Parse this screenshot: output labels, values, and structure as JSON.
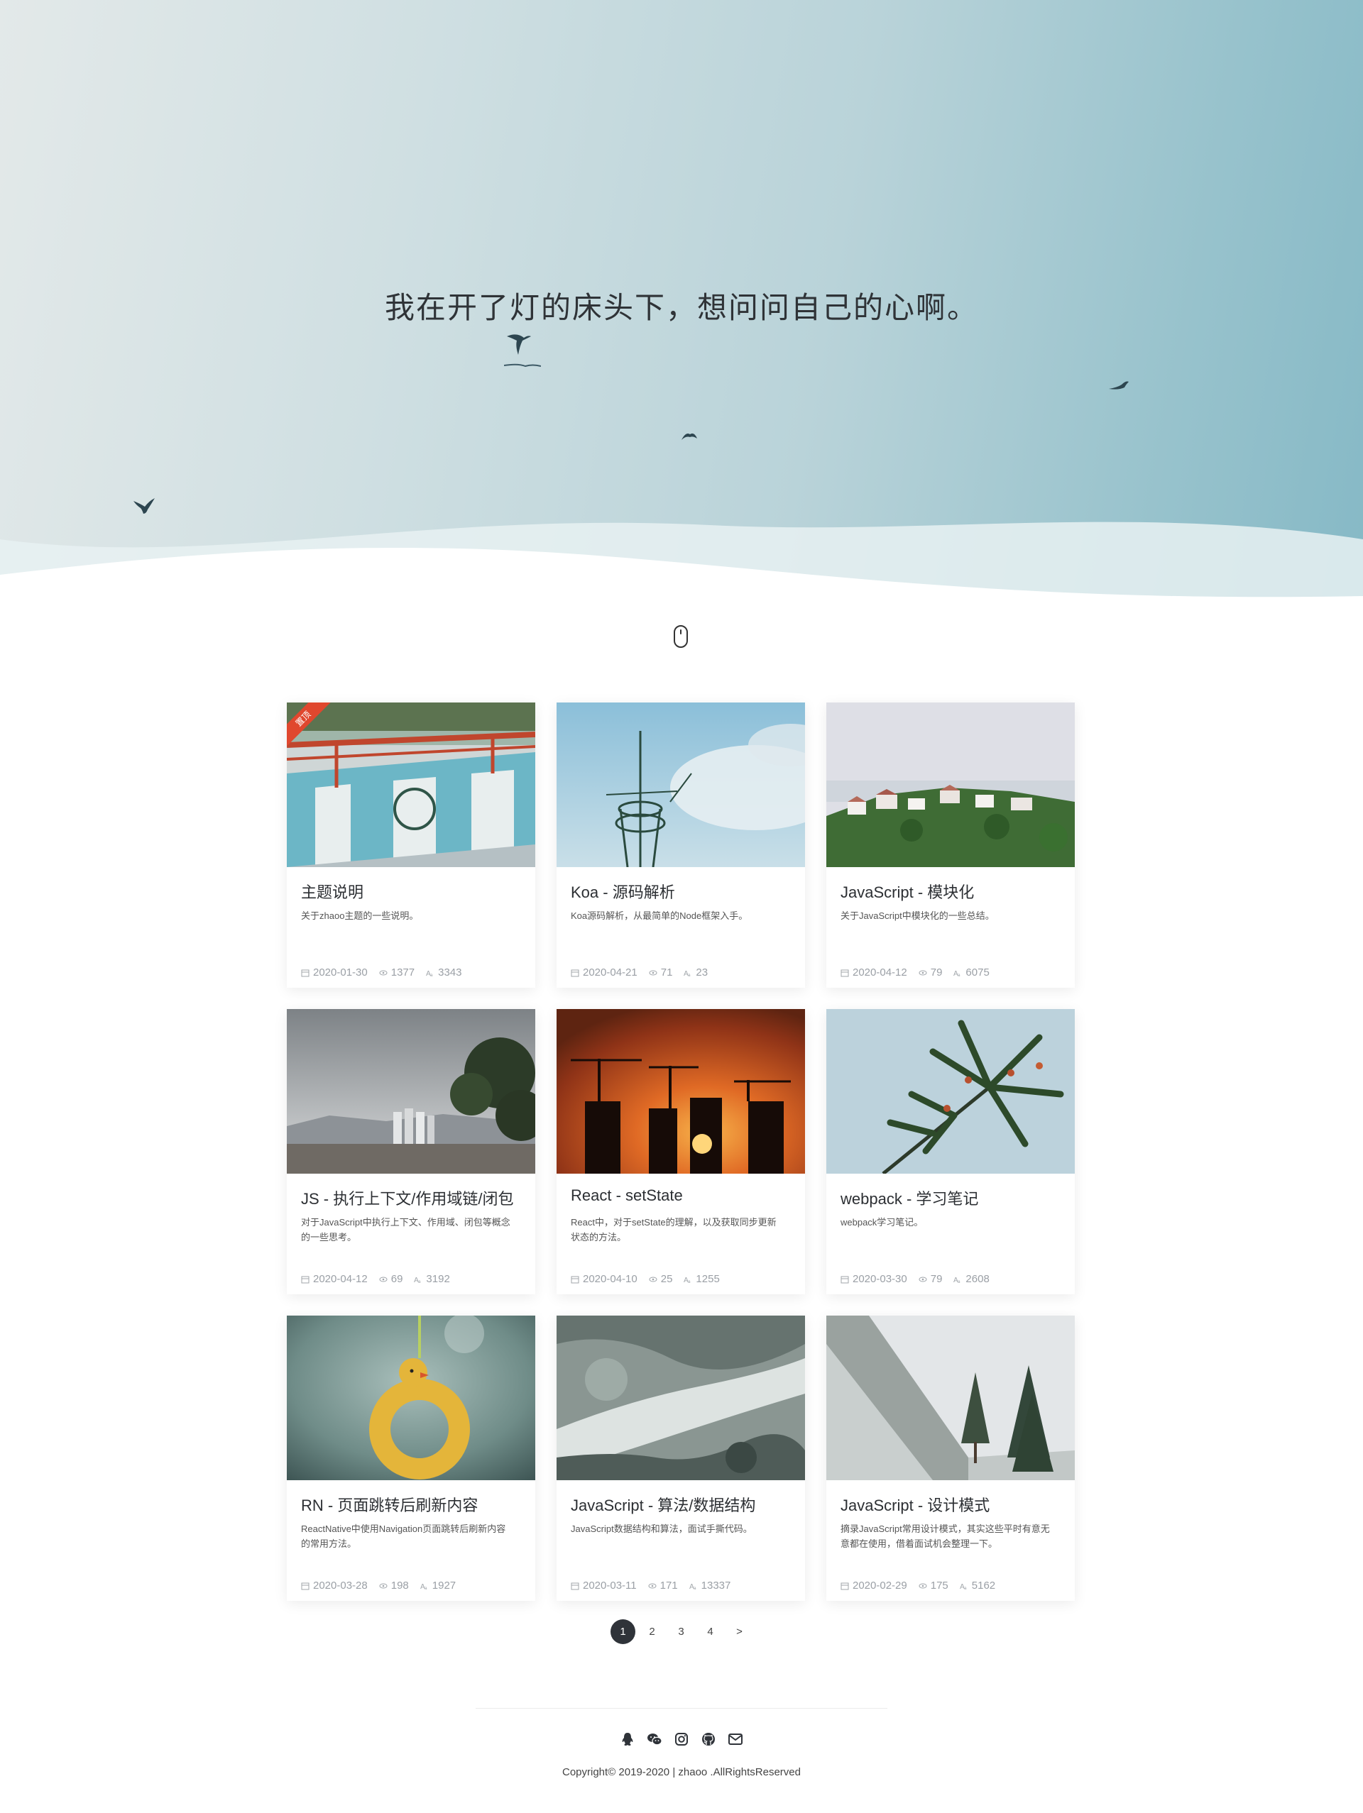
{
  "hero": {
    "quote": "我在开了灯的床头下，想问问自己的心啊。"
  },
  "posts": [
    {
      "title": "主题说明",
      "desc": "关于zhaoo主题的一些说明。",
      "date": "2020-01-30",
      "views": "1377",
      "words": "3343",
      "pinned_label": "置顶",
      "image": "railing"
    },
    {
      "title": "Koa - 源码解析",
      "desc": "Koa源码解析，从最简单的Node框架入手。",
      "date": "2020-04-21",
      "views": "71",
      "words": "23",
      "image": "antenna"
    },
    {
      "title": "JavaScript - 模块化",
      "desc": "关于JavaScript中模块化的一些总结。",
      "date": "2020-04-12",
      "views": "79",
      "words": "6075",
      "image": "village"
    },
    {
      "title": "JS - 执行上下文/作用域链/闭包",
      "desc": "对于JavaScript中执行上下文、作用域、闭包等概念的一些思考。",
      "date": "2020-04-12",
      "views": "69",
      "words": "3192",
      "image": "city-tree"
    },
    {
      "title": "React - setState",
      "desc": "React中，对于setState的理解，以及获取同步更新状态的方法。",
      "date": "2020-04-10",
      "views": "25",
      "words": "1255",
      "image": "sunset-cranes"
    },
    {
      "title": "webpack - 学习笔记",
      "desc": "webpack学习笔记。",
      "date": "2020-03-30",
      "views": "79",
      "words": "2608",
      "image": "pine-branch"
    },
    {
      "title": "RN - 页面跳转后刷新内容",
      "desc": "ReactNative中使用Navigation页面跳转后刷新内容的常用方法。",
      "date": "2020-03-28",
      "views": "198",
      "words": "1927",
      "image": "duck-ring"
    },
    {
      "title": "JavaScript - 算法/数据结构",
      "desc": "JavaScript数据结构和算法，面试手撕代码。",
      "date": "2020-03-11",
      "views": "171",
      "words": "13337",
      "image": "frost-rocks"
    },
    {
      "title": "JavaScript - 设计模式",
      "desc": "摘录JavaScript常用设计模式，其实这些平时有意无意都在使用，借着面试机会整理一下。",
      "date": "2020-02-29",
      "views": "175",
      "words": "5162",
      "image": "snowy-hill"
    }
  ],
  "pagination": {
    "pages": [
      "1",
      "2",
      "3",
      "4"
    ],
    "current": "1",
    "next": ">"
  },
  "footer": {
    "social_icons": [
      "qq-icon",
      "wechat-icon",
      "instagram-icon",
      "github-icon",
      "mail-icon"
    ],
    "copyright": "Copyright© 2019-2020 | zhaoo .AllRightsReserved"
  },
  "colors": {
    "ribbon": "#e0472e",
    "active_page": "#2f3339"
  }
}
